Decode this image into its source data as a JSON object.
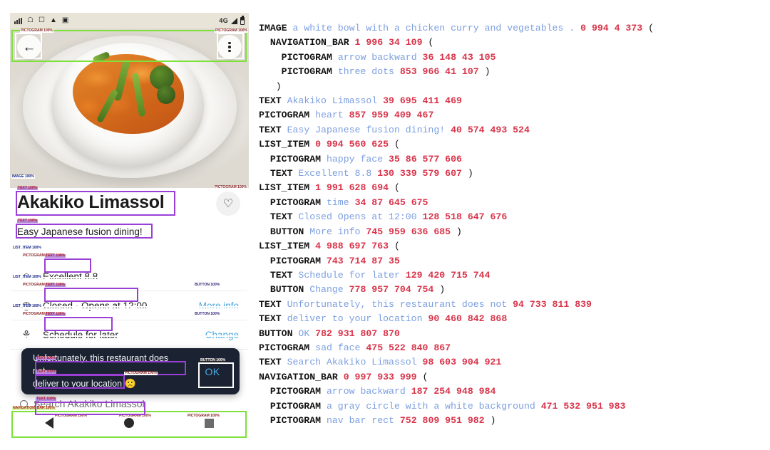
{
  "screenshot": {
    "app_kind": "restaurant-detail-screen",
    "status_bar": {
      "network": "4G",
      "icons": [
        "alarm-icon",
        "home-icon",
        "sim-icon",
        "warning-icon",
        "image-icon",
        "signal-bars-icon",
        "battery-icon"
      ]
    },
    "top_nav": {
      "back_icon": "←",
      "menu_icon": "three-dots"
    },
    "hero_image_alt": "a white bowl with a chicken curry and vegetables",
    "restaurant": {
      "title": "Akakiko Limassol",
      "subtitle": "Easy Japanese fusion dining!",
      "favorite_icon": "♡"
    },
    "rows": [
      {
        "icon": "☺",
        "icon_name": "happy-face-icon",
        "label": "Excellent 8.8",
        "action": ""
      },
      {
        "icon": "◴",
        "icon_name": "clock-icon",
        "label": "Closed · Opens at 12:00",
        "action": "More info"
      },
      {
        "icon": "⚘",
        "icon_name": "bike-delivery-icon",
        "label": "Schedule for later",
        "action": "Change"
      }
    ],
    "search": {
      "placeholder": "Search Akakiko Limassol",
      "icon": "search-icon"
    },
    "snackbar": {
      "line1": "Unfortunately, this restaurant does not",
      "line2": "deliver to your location",
      "emoji": "🙁",
      "ok_label": "OK"
    },
    "bottom_nav": {
      "back": "triangle-back-icon",
      "home": "circle-home-icon",
      "recents": "square-recents-icon"
    },
    "annotation_tags": {
      "navigation_bar": "NAVIGATION_BAR  100%",
      "pictogram": "PICTOGRAM  100%",
      "text": "TEXT  100%",
      "list_item": "LIST_ITEM  100%",
      "button": "BUTTON  100%",
      "image": "IMAGE  100%"
    },
    "colors": {
      "box_green": "#7ee03a",
      "box_purple": "#9a3fd6",
      "box_white": "#ffffff",
      "accent_blue": "#4aa8e0",
      "snackbar_bg": "#1b2333"
    }
  },
  "listing": {
    "colors": {
      "keyword": "#121212",
      "description": "#7c9fe0",
      "number": "#d9344a"
    },
    "lines": [
      {
        "indent": 0,
        "key": "IMAGE",
        "desc": "a white bowl with a chicken curry and vegetables .",
        "nums": "0 994 4 373",
        "tail": "("
      },
      {
        "indent": 1,
        "key": "NAVIGATION_BAR",
        "desc": "",
        "nums": "1 996 34 109",
        "tail": "("
      },
      {
        "indent": 2,
        "key": "PICTOGRAM",
        "desc": "arrow backward",
        "nums": "36 148 43 105",
        "tail": ""
      },
      {
        "indent": 2,
        "key": "PICTOGRAM",
        "desc": "three dots",
        "nums": "853 966 41 107",
        "tail": ")"
      },
      {
        "indent": 1,
        "key": "",
        "desc": "",
        "nums": "",
        "tail": ")"
      },
      {
        "indent": 0,
        "key": "TEXT",
        "desc": "Akakiko Limassol",
        "nums": "39 695 411 469",
        "tail": ""
      },
      {
        "indent": 0,
        "key": "PICTOGRAM",
        "desc": "heart",
        "nums": "857 959 409 467",
        "tail": ""
      },
      {
        "indent": 0,
        "key": "TEXT",
        "desc": "Easy Japanese fusion dining!",
        "nums": "40 574 493 524",
        "tail": ""
      },
      {
        "indent": 0,
        "key": "LIST_ITEM",
        "desc": "",
        "nums": "0 994 560 625",
        "tail": "("
      },
      {
        "indent": 1,
        "key": "PICTOGRAM",
        "desc": "happy face",
        "nums": "35 86 577 606",
        "tail": ""
      },
      {
        "indent": 1,
        "key": "TEXT",
        "desc": "Excellent 8.8",
        "nums": "130 339 579 607",
        "tail": ")"
      },
      {
        "indent": 0,
        "key": "LIST_ITEM",
        "desc": "",
        "nums": "1 991 628 694",
        "tail": "("
      },
      {
        "indent": 1,
        "key": "PICTOGRAM",
        "desc": "time",
        "nums": "34 87 645 675",
        "tail": ""
      },
      {
        "indent": 1,
        "key": "TEXT",
        "desc": "Closed Opens at 12:00",
        "nums": "128 518 647 676",
        "tail": ""
      },
      {
        "indent": 1,
        "key": "BUTTON",
        "desc": "More info",
        "nums": "745 959 636 685",
        "tail": ")"
      },
      {
        "indent": 0,
        "key": "LIST_ITEM",
        "desc": "",
        "nums": "4 988 697 763",
        "tail": "("
      },
      {
        "indent": 1,
        "key": "PICTOGRAM",
        "desc": "",
        "nums": "743 714 87 35",
        "tail": ""
      },
      {
        "indent": 1,
        "key": "TEXT",
        "desc": "Schedule for later",
        "nums": "129 420 715 744",
        "tail": ""
      },
      {
        "indent": 1,
        "key": "BUTTON",
        "desc": "Change",
        "nums": "778 957 704 754",
        "tail": ")"
      },
      {
        "indent": 0,
        "key": "TEXT",
        "desc": "Unfortunately, this restaurant does not",
        "nums": "94 733 811 839",
        "tail": ""
      },
      {
        "indent": 0,
        "key": "TEXT",
        "desc": "deliver to your location",
        "nums": "90 460 842 868",
        "tail": ""
      },
      {
        "indent": 0,
        "key": "BUTTON",
        "desc": "OK",
        "nums": "782 931 807 870",
        "tail": ""
      },
      {
        "indent": 0,
        "key": "PICTOGRAM",
        "desc": "sad face",
        "nums": "475 522 840 867",
        "tail": ""
      },
      {
        "indent": 0,
        "key": "TEXT",
        "desc": "Search Akakiko Limassol",
        "nums": "98 603 904 921",
        "tail": ""
      },
      {
        "indent": 0,
        "key": "NAVIGATION_BAR",
        "desc": "",
        "nums": "0 997 933 999",
        "tail": "("
      },
      {
        "indent": 1,
        "key": "PICTOGRAM",
        "desc": "arrow backward",
        "nums": "187 254 948 984",
        "tail": ""
      },
      {
        "indent": 1,
        "key": "PICTOGRAM",
        "desc": "a gray circle with a white background",
        "nums": "471 532 951 983",
        "tail": ""
      },
      {
        "indent": 1,
        "key": "PICTOGRAM",
        "desc": "nav bar rect",
        "nums": "752 809 951 982",
        "tail": ")"
      }
    ]
  }
}
